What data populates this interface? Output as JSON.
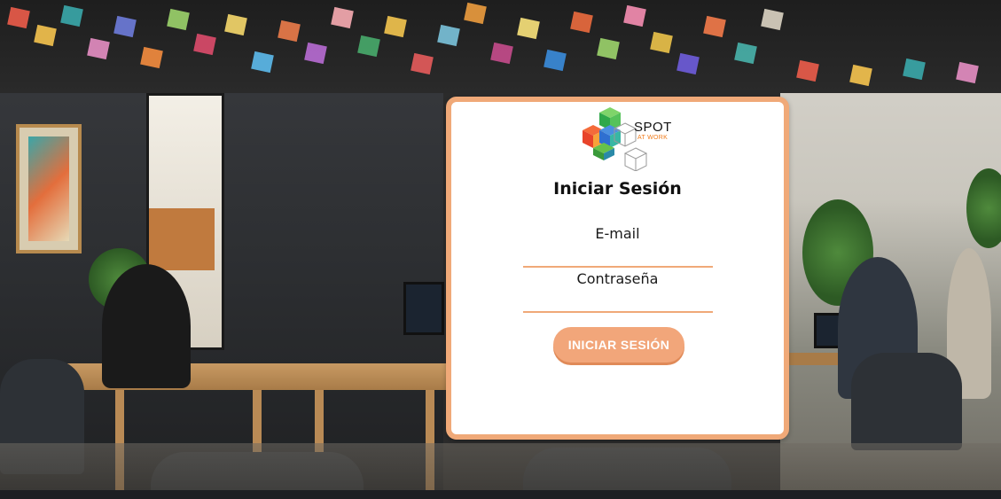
{
  "brand": {
    "name": "SPOT",
    "tagline": "AT WORK",
    "logo_icon": "cubes-logo-icon",
    "colors": {
      "accent": "#f0a978",
      "button": "#f2a67a",
      "tagline": "#f07b1a"
    }
  },
  "login": {
    "title": "Iniciar Sesión",
    "email_label": "E-mail",
    "email_value": "",
    "password_label": "Contraseña",
    "password_value": "",
    "submit_label": "INICIAR SESIÓN"
  }
}
